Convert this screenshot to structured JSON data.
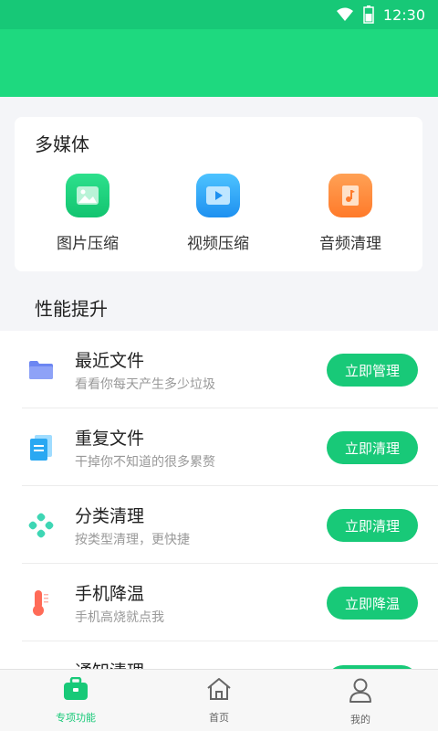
{
  "status_bar": {
    "time": "12:30",
    "wifi_icon": "wifi-icon",
    "battery_icon": "battery-icon"
  },
  "multimedia": {
    "title": "多媒体",
    "items": [
      {
        "label": "图片压缩",
        "icon": "image-compress-icon",
        "color": "#1bcf7e"
      },
      {
        "label": "视频压缩",
        "icon": "video-compress-icon",
        "color": "#2ba6f5"
      },
      {
        "label": "音频清理",
        "icon": "audio-clean-icon",
        "color": "#ff8a3d"
      }
    ]
  },
  "performance": {
    "title": "性能提升",
    "items": [
      {
        "title": "最近文件",
        "subtitle": "看看你每天产生多少垃圾",
        "button": "立即管理",
        "icon": "folder-icon"
      },
      {
        "title": "重复文件",
        "subtitle": "干掉你不知道的很多累赘",
        "button": "立即清理",
        "icon": "duplicate-file-icon"
      },
      {
        "title": "分类清理",
        "subtitle": "按类型清理，更快捷",
        "button": "立即清理",
        "icon": "category-icon"
      },
      {
        "title": "手机降温",
        "subtitle": "手机高烧就点我",
        "button": "立即降温",
        "icon": "thermometer-icon"
      },
      {
        "title": "通知清理",
        "subtitle": "",
        "button": "",
        "icon": "notification-icon"
      }
    ]
  },
  "tabs": [
    {
      "label": "专项功能",
      "icon": "toolbox-icon",
      "active": true
    },
    {
      "label": "首页",
      "icon": "home-icon",
      "active": false
    },
    {
      "label": "我的",
      "icon": "user-icon",
      "active": false
    }
  ],
  "colors": {
    "primary": "#1ed97f",
    "status_bar": "#17c877",
    "button": "#18c978"
  }
}
